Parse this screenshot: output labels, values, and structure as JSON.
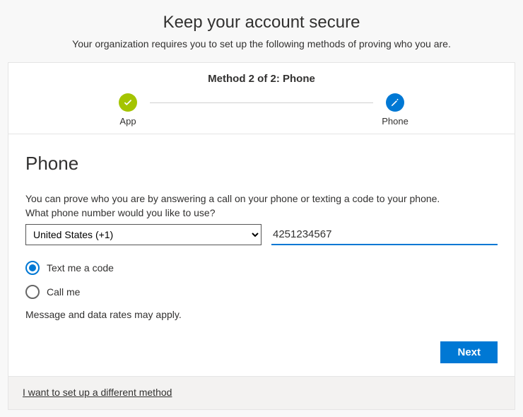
{
  "page": {
    "title": "Keep your account secure",
    "subtitle": "Your organization requires you to set up the following methods of proving who you are."
  },
  "stepper": {
    "title": "Method 2 of 2: Phone",
    "steps": [
      {
        "label": "App",
        "status": "done"
      },
      {
        "label": "Phone",
        "status": "active"
      }
    ]
  },
  "section": {
    "heading": "Phone",
    "instruction": "You can prove who you are by answering a call on your phone or texting a code to your phone.",
    "prompt": "What phone number would you like to use?",
    "country_selected": "United States (+1)",
    "phone_value": "4251234567",
    "options": {
      "text_me": "Text me a code",
      "call_me": "Call me",
      "selected": "text_me"
    },
    "disclaimer": "Message and data rates may apply.",
    "next_label": "Next"
  },
  "footer": {
    "alt_method_link": "I want to set up a different method"
  }
}
